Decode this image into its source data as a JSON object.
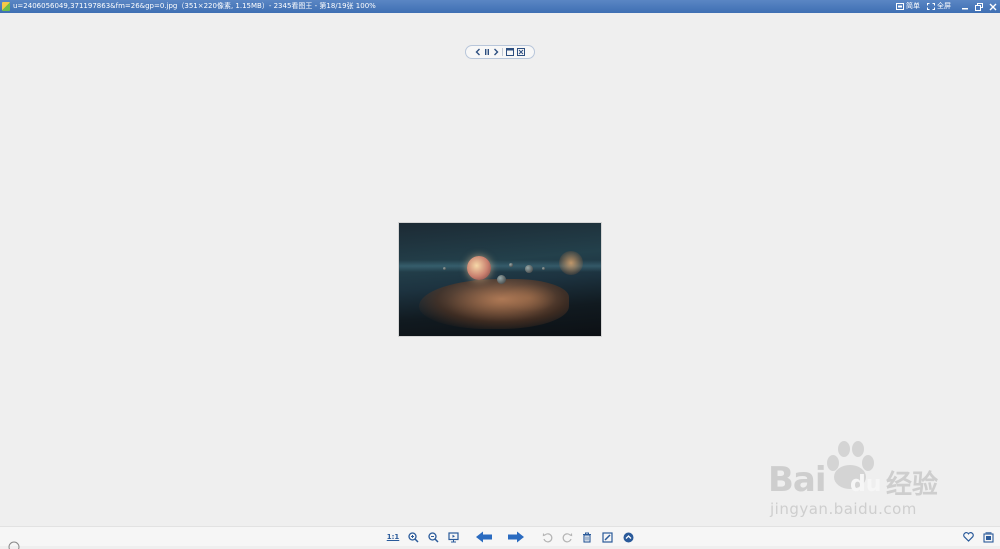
{
  "window": {
    "title": "u=2406056049,371197863&fm=26&gp=0.jpg（351×220像素, 1.15MB）- 2345看图王 - 第18/19张 100%",
    "buttons": {
      "simple_label": "简单",
      "fullscreen_label": "全屏"
    }
  },
  "toolbar": {
    "ratio_label": "1:1",
    "items": [
      "actual-size",
      "zoom-in",
      "zoom-out",
      "slideshow",
      "previous",
      "next",
      "rotate-left",
      "rotate-right",
      "delete",
      "edit",
      "more",
      "favorite",
      "menu"
    ]
  },
  "watermark": {
    "brand": "Bai",
    "brand2": "du",
    "cn": "经验",
    "url": "jingyan.baidu.com"
  },
  "colors": {
    "titlebar": "#4a79bd",
    "accent_blue": "#2a6bc0",
    "background": "#efefef"
  }
}
